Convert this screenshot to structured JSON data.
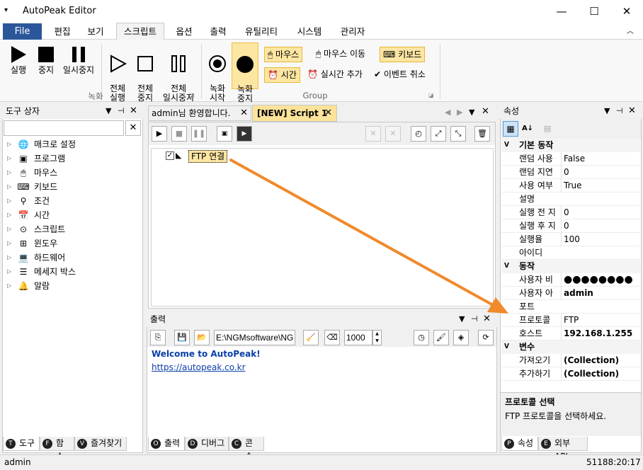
{
  "window": {
    "title": "AutoPeak Editor",
    "qa_icon": "quick-access-caret-icon"
  },
  "menu": {
    "file": "File",
    "items": [
      "편집",
      "보기",
      "스크립트",
      "옵션",
      "출력",
      "유틸리티",
      "시스템",
      "관리자"
    ]
  },
  "ribbon": {
    "run": "실행",
    "stop": "중지",
    "pause": "일시중지",
    "run_all": "전체\n실행",
    "stop_all": "전체\n중지",
    "pause_all": "전체\n일시중지",
    "record_start": "녹화\n시작",
    "record_stop": "녹화\n중지",
    "mouse": "마우스",
    "mouse_move": "마우스 이동",
    "keyboard": "키보드",
    "time": "시간",
    "realtime_add": "실시간 추가",
    "event_cancel": "이벤트 취소",
    "group_record": "녹화",
    "group_group": "Group"
  },
  "toolbox": {
    "title": "도구 상자",
    "search_value": "",
    "items": [
      "매크로 설정",
      "프로그램",
      "마우스",
      "키보드",
      "조건",
      "시간",
      "스크립트",
      "윈도우",
      "하드웨어",
      "메세지 박스",
      "알람"
    ],
    "tabs": [
      {
        "letter": "T",
        "label": "도구"
      },
      {
        "letter": "F",
        "label": "함수"
      },
      {
        "letter": "V",
        "label": "즐겨찾기"
      }
    ]
  },
  "editor": {
    "tabs": [
      "admin님 환영합니다.",
      "[NEW] Script 1"
    ],
    "node_label": "FTP 연결",
    "node_checked": true
  },
  "output": {
    "title": "출력",
    "path_value": "E:\\NGMsoftware\\NG",
    "count_value": "1000",
    "lines": [
      "Welcome to AutoPeak!",
      "https://autopeak.co.kr"
    ],
    "tabs": [
      {
        "letter": "O",
        "label": "출력"
      },
      {
        "letter": "D",
        "label": "디버그"
      },
      {
        "letter": "C",
        "label": "콘솔"
      }
    ]
  },
  "properties": {
    "title": "속성",
    "categories": [
      {
        "name": "기본 동작",
        "rows": [
          {
            "key": "랜덤 사용",
            "value": "False",
            "bold": false
          },
          {
            "key": "랜덤 지연",
            "value": "0",
            "bold": false
          },
          {
            "key": "사용 여부",
            "value": "True",
            "bold": false
          },
          {
            "key": "설명",
            "value": "",
            "bold": false
          },
          {
            "key": "실행 전 지",
            "value": "0",
            "bold": false
          },
          {
            "key": "실행 후 지",
            "value": "0",
            "bold": false
          },
          {
            "key": "실행율",
            "value": "100",
            "bold": false
          },
          {
            "key": "아이디",
            "value": "",
            "bold": false
          }
        ]
      },
      {
        "name": "동작",
        "rows": [
          {
            "key": "사용자 비",
            "value": "●●●●●●●●",
            "bold": true
          },
          {
            "key": "사용자 아",
            "value": "admin",
            "bold": true
          },
          {
            "key": "포트",
            "value": "",
            "bold": false
          },
          {
            "key": "프로토콜",
            "value": "FTP",
            "bold": false
          },
          {
            "key": "호스트",
            "value": "192.168.1.255",
            "bold": true
          }
        ]
      },
      {
        "name": "변수",
        "rows": [
          {
            "key": "가져오기",
            "value": "(Collection)",
            "bold": true
          },
          {
            "key": "추가하기",
            "value": "(Collection)",
            "bold": true
          }
        ]
      }
    ],
    "help_title": "프로토콜 선택",
    "help_text": "FTP 프로토콜을 선택하세요.",
    "tabs": [
      {
        "letter": "P",
        "label": "속성"
      },
      {
        "letter": "E",
        "label": "외부 API"
      }
    ]
  },
  "status": {
    "user": "admin",
    "time": "51188:20:17"
  },
  "colors": {
    "file_menu": "#2b579a",
    "highlight": "#fce6a2",
    "arrow": "#f08a2c",
    "link": "#0b3fa8"
  }
}
